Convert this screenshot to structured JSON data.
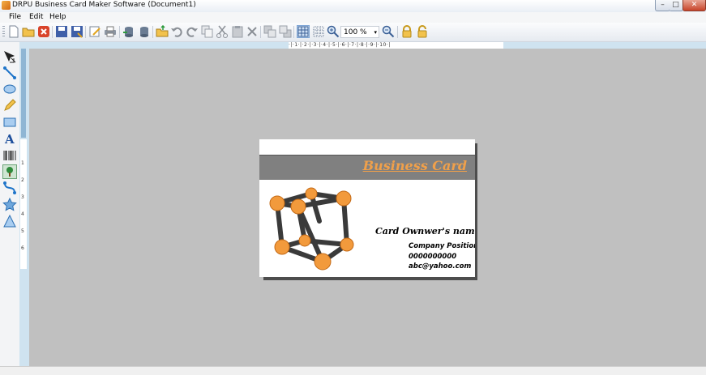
{
  "window": {
    "title": "DRPU Business Card Maker Software  (Document1)",
    "minimize_glyph": "–",
    "maximize_glyph": "□",
    "close_glyph": "✕"
  },
  "menu": [
    "File",
    "Edit",
    "Help"
  ],
  "toolbar": {
    "zoom_value": "100 %",
    "zoom_arrow": "▾",
    "icons": [
      "new-document-icon",
      "open-folder-icon",
      "close-document-icon",
      "save-icon",
      "save-as-icon",
      "edit-icon",
      "print-icon",
      "database-import-icon",
      "database-icon",
      "open-icon",
      "undo-icon",
      "redo-icon",
      "copy-icon",
      "cut-icon",
      "paste-icon",
      "delete-icon",
      "bring-front-icon",
      "send-back-icon",
      "grid-icon",
      "snap-grid-icon",
      "zoom-in-icon",
      "zoom-out-icon",
      "lock-icon",
      "unlock-icon"
    ]
  },
  "ruler": {
    "horizontal_labels": "·|·1·|·2·|·3·|·4·|·5·|·6·|·7·|·8·|·9·|·10·|",
    "vertical_labels": [
      "1",
      "2",
      "3",
      "4",
      "5",
      "6"
    ]
  },
  "tools": [
    "pointer-tool-icon",
    "line-tool-icon",
    "ellipse-tool-icon",
    "pencil-tool-icon",
    "rectangle-tool-icon",
    "text-tool-icon",
    "barcode-tool-icon",
    "image-tool-icon",
    "curve-tool-icon",
    "star-tool-icon",
    "triangle-tool-icon"
  ],
  "card": {
    "title": "Business Card",
    "owner_name": "Card Ownwer's name",
    "position": "Company Position",
    "phone": "0000000000",
    "email": "abc@yahoo.com",
    "colors": {
      "band": "#808080",
      "title": "#f0a04a",
      "sphere": "#f29a3c"
    }
  },
  "colors": {
    "canvas": "#c0c0c0",
    "ruler_strip": "#cfe3f0"
  }
}
